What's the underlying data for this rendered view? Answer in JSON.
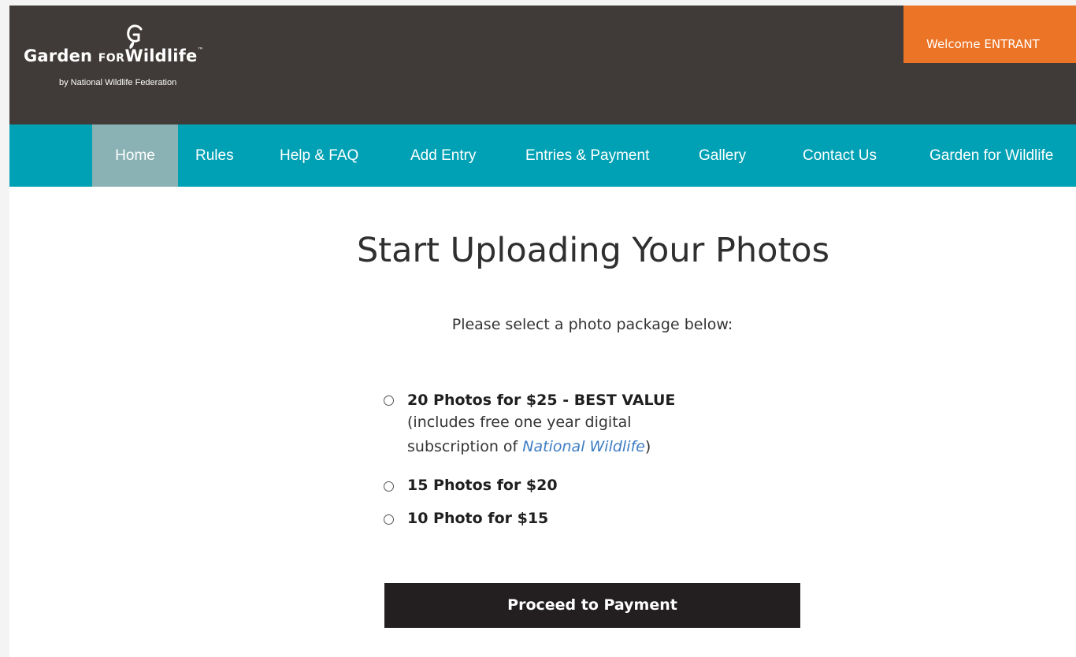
{
  "header": {
    "logo": {
      "word_garden": "Garden",
      "word_for": "FOR",
      "word_wildlife": "Wildlife",
      "trademark": "™",
      "tagline": "by National Wildlife Federation",
      "icon": "garden-g-leaf-icon"
    },
    "welcome_label": "Welcome ENTRANT",
    "colors": {
      "header_bg": "#403b38",
      "welcome_bg": "#ec7426"
    }
  },
  "nav": {
    "color": "#00a1b4",
    "active_color": "#8ab2b5",
    "items": [
      {
        "label": "Home",
        "active": true
      },
      {
        "label": "Rules"
      },
      {
        "label": "Help & FAQ"
      },
      {
        "label": "Add Entry"
      },
      {
        "label": "Entries & Payment"
      },
      {
        "label": "Gallery"
      },
      {
        "label": "Contact Us"
      },
      {
        "label": "Garden for Wildlife"
      }
    ]
  },
  "main": {
    "title": "Start Uploading Your Photos",
    "instruction": "Please select a photo package below:",
    "packages": [
      {
        "label": "20 Photos for $25 - BEST VALUE",
        "desc_line1": "(includes free one year digital",
        "desc_line2_prefix": "subscription of ",
        "desc_line2_magazine": "National Wildlife",
        "desc_line2_suffix": ")",
        "selected": false
      },
      {
        "label": "15 Photos for $20",
        "selected": false
      },
      {
        "label": "10 Photo for $15",
        "selected": false
      }
    ],
    "proceed_label": "Proceed to Payment"
  }
}
